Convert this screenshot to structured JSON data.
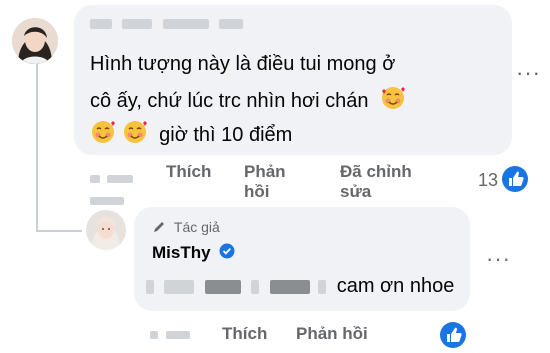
{
  "comment": {
    "text_line1": "Hình tượng này là điều tui mong ở",
    "text_line2": "cô ấy, chứ lúc trc nhìn hơi chán",
    "text_line3": "giờ thì 10 điểm",
    "actions": {
      "like": "Thích",
      "reply_line1": "Phản",
      "reply_line2": "hồi",
      "edited_line1": "Đã chỉnh",
      "edited_line2": "sửa"
    },
    "reaction_count": "13",
    "more_icon": "more-horizontal-icon",
    "emoji_icon": "smiling-face-with-hearts-emoji",
    "reaction_icon": "like-icon"
  },
  "reply": {
    "author_badge": "Tác giả",
    "author_name": "MisThy",
    "text": "cam ơn nhoe",
    "actions": {
      "like": "Thích",
      "reply": "Phản hồi"
    },
    "badge_icon": "pen-icon",
    "verified_icon": "verified-badge-icon",
    "reaction_icon": "like-icon"
  },
  "colors": {
    "bubble": "#f0f2f5",
    "secondary_text": "#65676b",
    "like_blue": "#1b74e4"
  }
}
